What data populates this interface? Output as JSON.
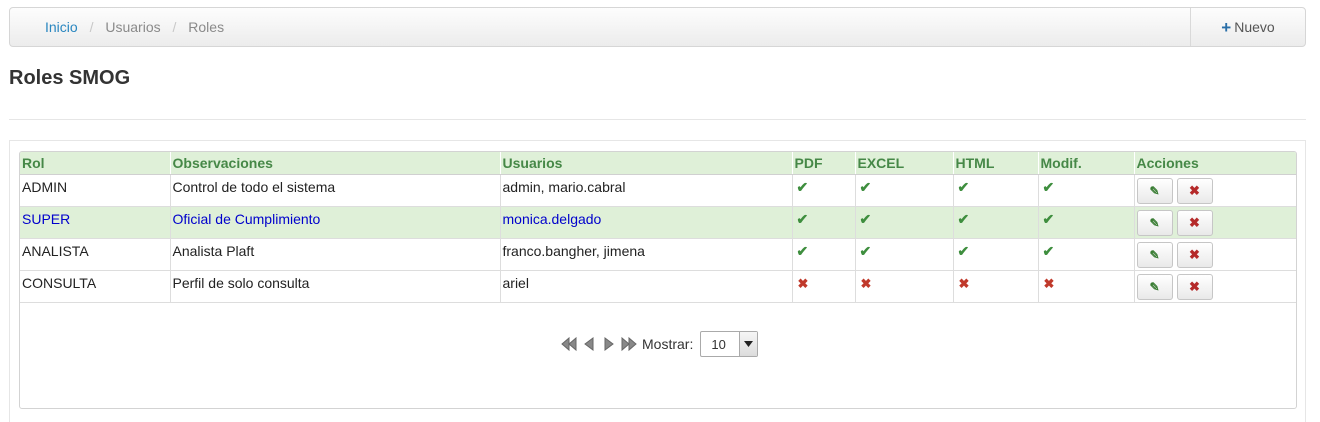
{
  "breadcrumb": {
    "items": [
      "Inicio",
      "Usuarios",
      "Roles"
    ],
    "separator": "/"
  },
  "toolbar": {
    "new_label": "Nuevo",
    "new_icon": "plus-icon"
  },
  "page": {
    "title": "Roles SMOG"
  },
  "table": {
    "columns": [
      "Rol",
      "Observaciones",
      "Usuarios",
      "PDF",
      "EXCEL",
      "HTML",
      "Modif.",
      "Acciones"
    ],
    "rows": [
      {
        "rol": "ADMIN",
        "obs": "Control de todo el sistema",
        "usuarios": "admin, mario.cabral",
        "pdf": "✔",
        "excel": "✔",
        "html": "✔",
        "modif": "✔"
      },
      {
        "rol": "SUPER",
        "obs": "Oficial de Cumplimiento",
        "usuarios": "monica.delgado",
        "pdf": "✔",
        "excel": "✔",
        "html": "✔",
        "modif": "✔"
      },
      {
        "rol": "ANALISTA",
        "obs": "Analista Plaft",
        "usuarios": "franco.bangher, jimena",
        "pdf": "✔",
        "excel": "✔",
        "html": "✔",
        "modif": "✔"
      },
      {
        "rol": "CONSULTA",
        "obs": "Perfil de solo consulta",
        "usuarios": "ariel",
        "pdf": "✖",
        "excel": "✖",
        "html": "✖",
        "modif": "✖"
      }
    ],
    "highlighted_row": 1,
    "action_icons": {
      "edit": "pencil-icon",
      "delete": "delete-x-icon"
    },
    "action_glyphs": {
      "edit": "✎",
      "delete": "✖"
    }
  },
  "pager": {
    "show_label": "Mostrar:",
    "page_size": "10",
    "icons": [
      "first-page-icon",
      "prev-page-icon",
      "next-page-icon",
      "last-page-icon"
    ]
  },
  "colors": {
    "header_bg": "#dff0d8",
    "header_text": "#468847",
    "highlight_text": "#0000cc",
    "ok": "#3e8e3e",
    "no": "#c0392b",
    "link": "#2a87c0"
  }
}
